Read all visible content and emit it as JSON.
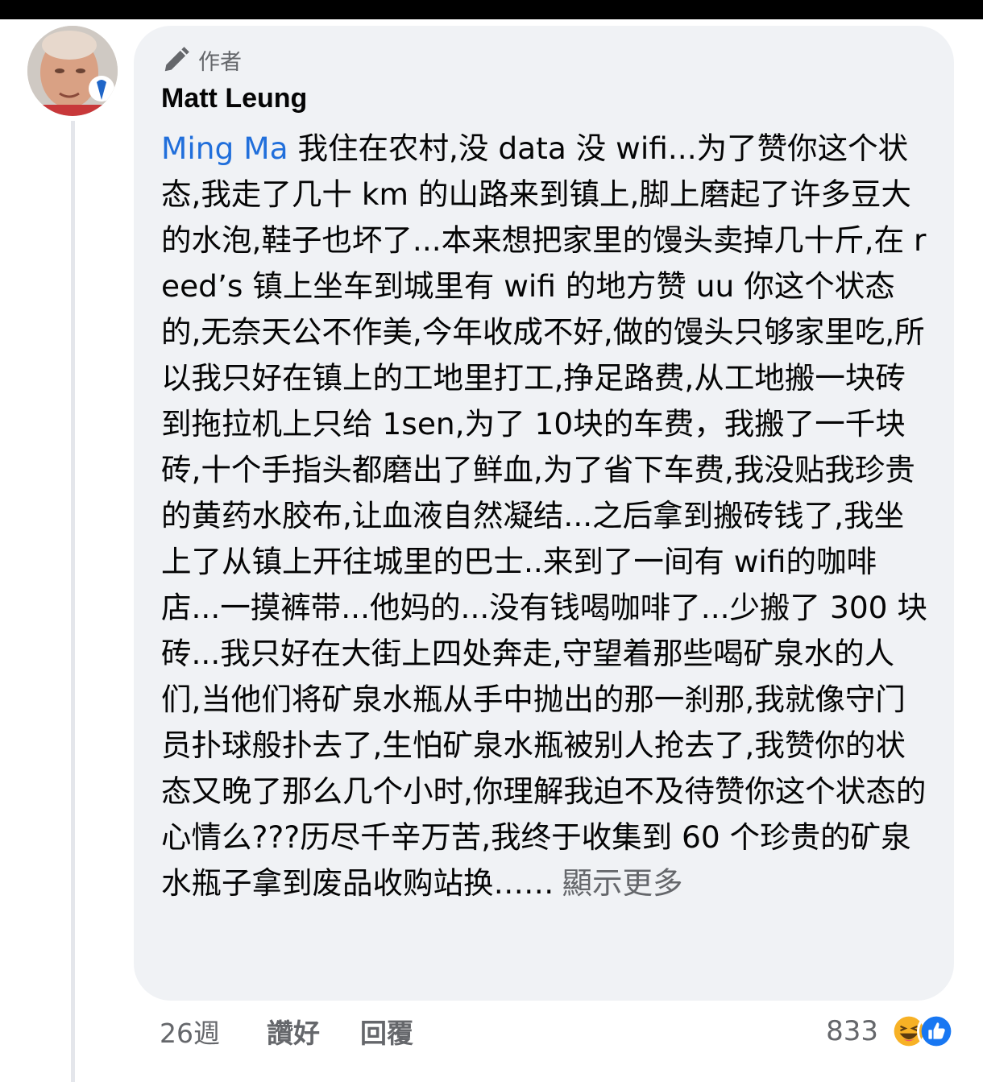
{
  "comment": {
    "author_badge": "作者",
    "author_name": "Matt Leung",
    "mention": "Ming Ma",
    "body": " 我住在农村,没 data 没 wifi...为了赞你这个状态,我走了几十 km 的山路来到镇上,脚上磨起了许多豆大的水泡,鞋子也坏了...本来想把家里的馒头卖掉几十斤,在 reed’s 镇上坐车到城里有 wifi 的地方赞 uu 你这个状态的,无奈天公不作美,今年收成不好,做的馒头只够家里吃,所以我只好在镇上的工地里打工,挣足路费,从工地搬一块砖到拖拉机上只给 1sen,为了 10块的车费，我搬了一千块砖,十个手指头都磨出了鲜血,为了省下车费,我没贴我珍贵的黄药水胶布,让血液自然凝结...之后拿到搬砖钱了,我坐上了从镇上开往城里的巴士..来到了一间有 wifi的咖啡店...一摸裤带...他妈的...没有钱喝咖啡了...少搬了 300 块砖...我只好在大街上四处奔走,守望着那些喝矿泉水的人们,当他们将矿泉水瓶从手中抛出的那一刹那,我就像守门员扑球般扑去了,生怕矿泉水瓶被别人抢去了,我赞你的状态又晚了那么几个小时,你理解我迫不及待赞你这个状态的心情么???历尽千辛万苦,我终于收集到 60 个珍贵的矿泉水瓶子拿到废品收购站换……",
    "see_more": "顯示更多"
  },
  "actions": {
    "time": "26週",
    "like": "讚好",
    "reply": "回覆"
  },
  "reactions": {
    "count": "833",
    "icons": [
      "haha-icon",
      "like-icon"
    ]
  },
  "colors": {
    "mention": "#216fdb",
    "bubble": "#f0f2f5",
    "secondary_text": "#65676b",
    "like_blue": "#1877f2",
    "haha_yellow": "#f7b125"
  }
}
